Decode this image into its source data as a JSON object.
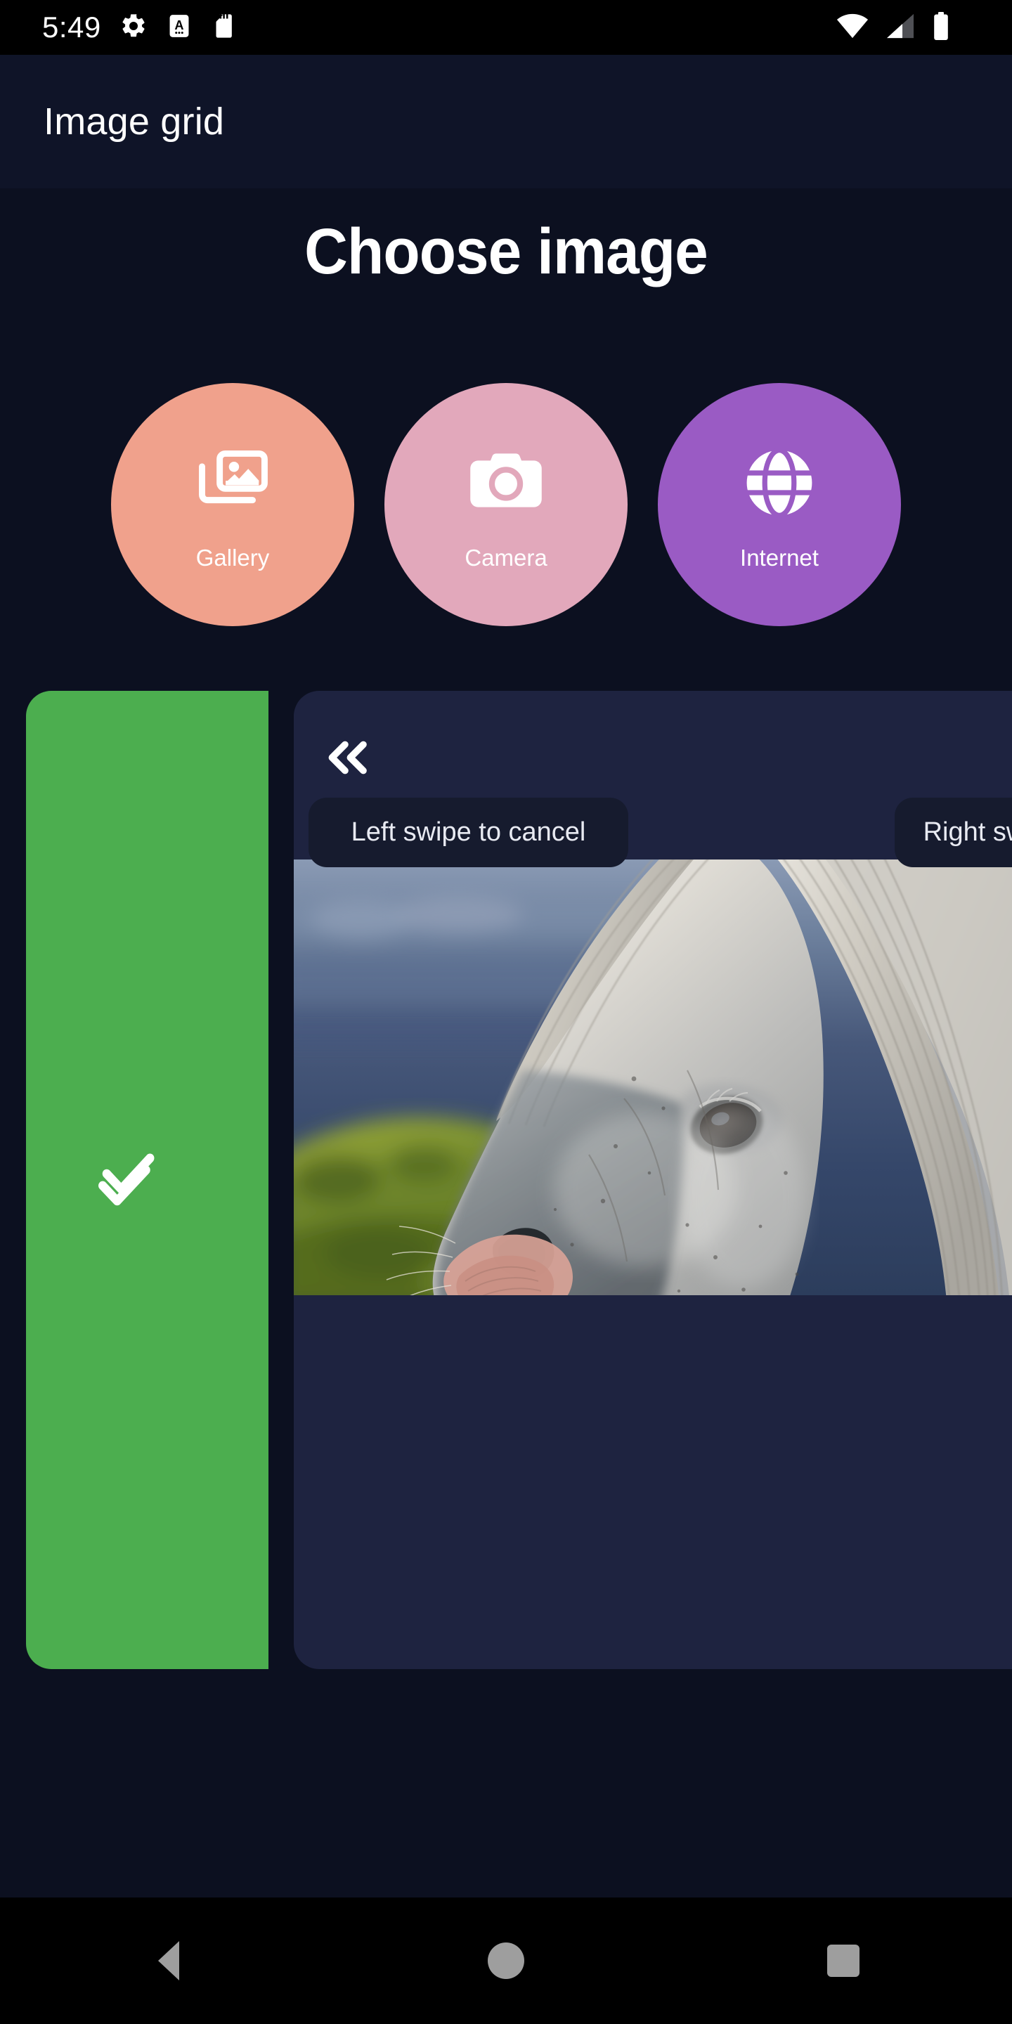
{
  "status_bar": {
    "time": "5:49",
    "left_icons": [
      "gear-icon",
      "android-auto-icon",
      "sd-card-icon"
    ],
    "right_icons": [
      "wifi-icon",
      "cellular-signal-icon",
      "battery-icon"
    ]
  },
  "app_bar": {
    "title": "Image grid"
  },
  "page": {
    "heading": "Choose image"
  },
  "chooser": {
    "options": [
      {
        "label": "Gallery",
        "icon": "photo-library-icon",
        "color": "#f0a18c"
      },
      {
        "label": "Camera",
        "icon": "camera-icon",
        "color": "#e2a8bb"
      },
      {
        "label": "Internet",
        "icon": "globe-icon",
        "color": "#9a5bc4"
      }
    ]
  },
  "swipe_item": {
    "action_panel": {
      "color": "#4cae4f",
      "icon": "done-all-icon"
    },
    "card": {
      "color": "#1e2340",
      "chevron_icon": "double-chevron-left-icon",
      "tooltip_left": "Left swipe to cancel",
      "tooltip_right": "Right swipe to confirm",
      "image_alt": "white horse head portrait"
    }
  },
  "nav_bar": {
    "back": "back-icon",
    "home": "home-icon",
    "recents": "recents-icon"
  },
  "colors": {
    "background": "#0c1020",
    "app_bar": "#0f1428",
    "status_bar": "#000000",
    "green": "#4cae4f",
    "card": "#1e2340",
    "tooltip": "#161b2e"
  }
}
